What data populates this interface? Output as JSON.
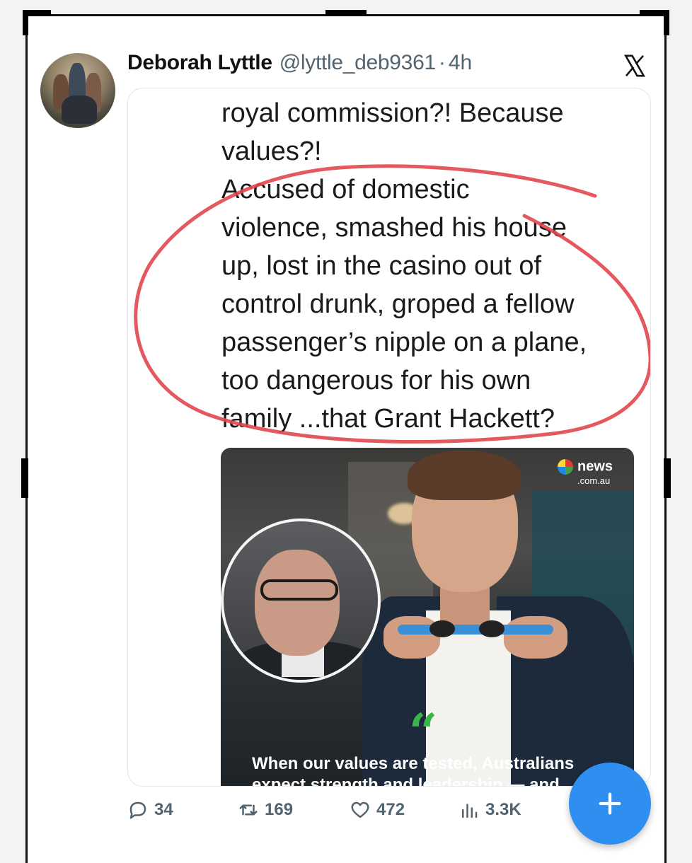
{
  "tweet": {
    "display_name": "Deborah Lyttle",
    "handle": "@lyttle_deb9361",
    "separator": "·",
    "time": "4h",
    "text_lines": [
      "royal commission?! Because",
      "values?!",
      "Accused of domestic",
      "violence, smashed his house",
      "up, lost in the casino out of",
      "control drunk, groped a fellow",
      "passenger’s nipple on a plane,",
      "too dangerous for his own",
      "family ...that Grant Hackett?"
    ],
    "annotation_color": "#e0474c"
  },
  "media": {
    "logo_text": "news",
    "logo_subtext": ".com.au",
    "quote_mark": "“",
    "caption_line1": "When our values are tested, Australians",
    "caption_line2": "expect strength and leadership — and"
  },
  "actions": {
    "reply_count": "34",
    "retweet_count": "169",
    "like_count": "472",
    "views_count": "3.3K"
  },
  "icons": {
    "reply": "reply-icon",
    "retweet": "retweet-icon",
    "like": "heart-icon",
    "views": "views-icon",
    "platform": "x-logo-icon",
    "compose": "plus-icon"
  },
  "colors": {
    "accent": "#2f8ff0",
    "muted_text": "#536471",
    "annotation": "#e0474c"
  }
}
